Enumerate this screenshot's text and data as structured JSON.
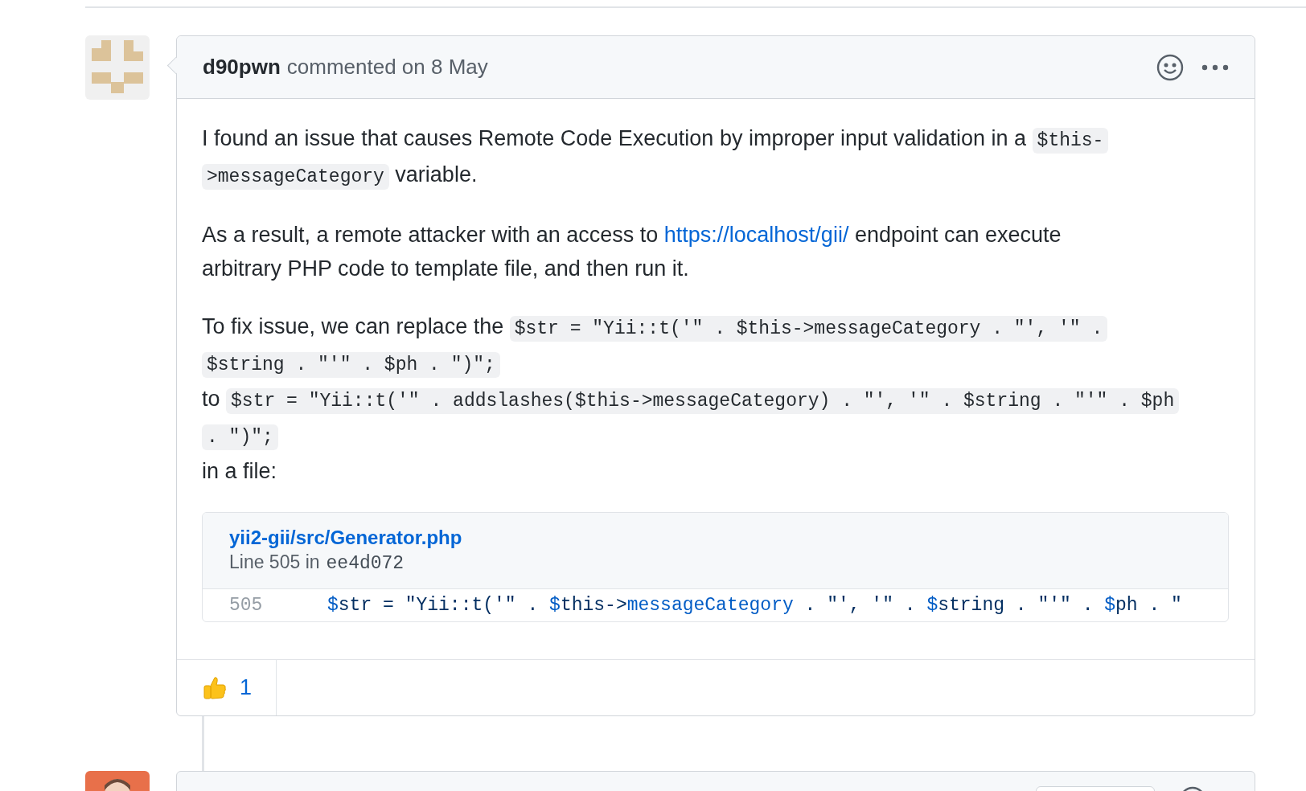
{
  "comment": {
    "author": "d90pwn",
    "meta": "commented on 8 May",
    "paragraphs": [
      [
        [
          {
            "kind": "text",
            "text": "I found an issue that causes Remote Code Execution by improper input validation in a "
          },
          {
            "kind": "code",
            "text": "$this-"
          }
        ],
        [
          {
            "kind": "code",
            "text": ">messageCategory"
          },
          {
            "kind": "text",
            "text": " variable."
          }
        ]
      ],
      [
        [
          {
            "kind": "text",
            "text": "As a result, a remote attacker with an access to "
          },
          {
            "kind": "link",
            "text": "https://localhost/gii/"
          },
          {
            "kind": "text",
            "text": " endpoint can execute"
          }
        ],
        [
          {
            "kind": "text",
            "text": "arbitrary PHP code to template file, and then run it."
          }
        ]
      ],
      [
        [
          {
            "kind": "text",
            "text": "To fix issue, we can replace the "
          },
          {
            "kind": "code",
            "text": "$str = \"Yii::t('\" . $this->messageCategory . \"', '\" ."
          }
        ],
        [
          {
            "kind": "code",
            "text": "$string . \"'\" . $ph . \")\";"
          }
        ],
        [
          {
            "kind": "text",
            "text": "to "
          },
          {
            "kind": "code",
            "text": "$str = \"Yii::t('\" . addslashes($this->messageCategory) . \"', '\" . $string . \"'\" . $ph"
          }
        ],
        [
          {
            "kind": "code",
            "text": ". \")\";"
          }
        ],
        [
          {
            "kind": "text",
            "text": "in a file:"
          }
        ]
      ]
    ],
    "reference": {
      "path": "yii2-gii/src/Generator.php",
      "line_label": "Line 505 in",
      "commit": "ee4d072",
      "line_number": "505",
      "tokens": [
        {
          "kind": "sigil",
          "text": "$"
        },
        {
          "kind": "plain",
          "text": "str = \"Yii::t('\" . "
        },
        {
          "kind": "sigil",
          "text": "$"
        },
        {
          "kind": "plain",
          "text": "this->"
        },
        {
          "kind": "prop",
          "text": "messageCategory"
        },
        {
          "kind": "plain",
          "text": " . \"', '\" . "
        },
        {
          "kind": "sigil",
          "text": "$"
        },
        {
          "kind": "plain",
          "text": "string . \"'\" . "
        },
        {
          "kind": "sigil",
          "text": "$"
        },
        {
          "kind": "plain",
          "text": "ph . \""
        }
      ]
    },
    "reactions": [
      {
        "kind": "thumbs_up",
        "count": "1"
      }
    ]
  }
}
